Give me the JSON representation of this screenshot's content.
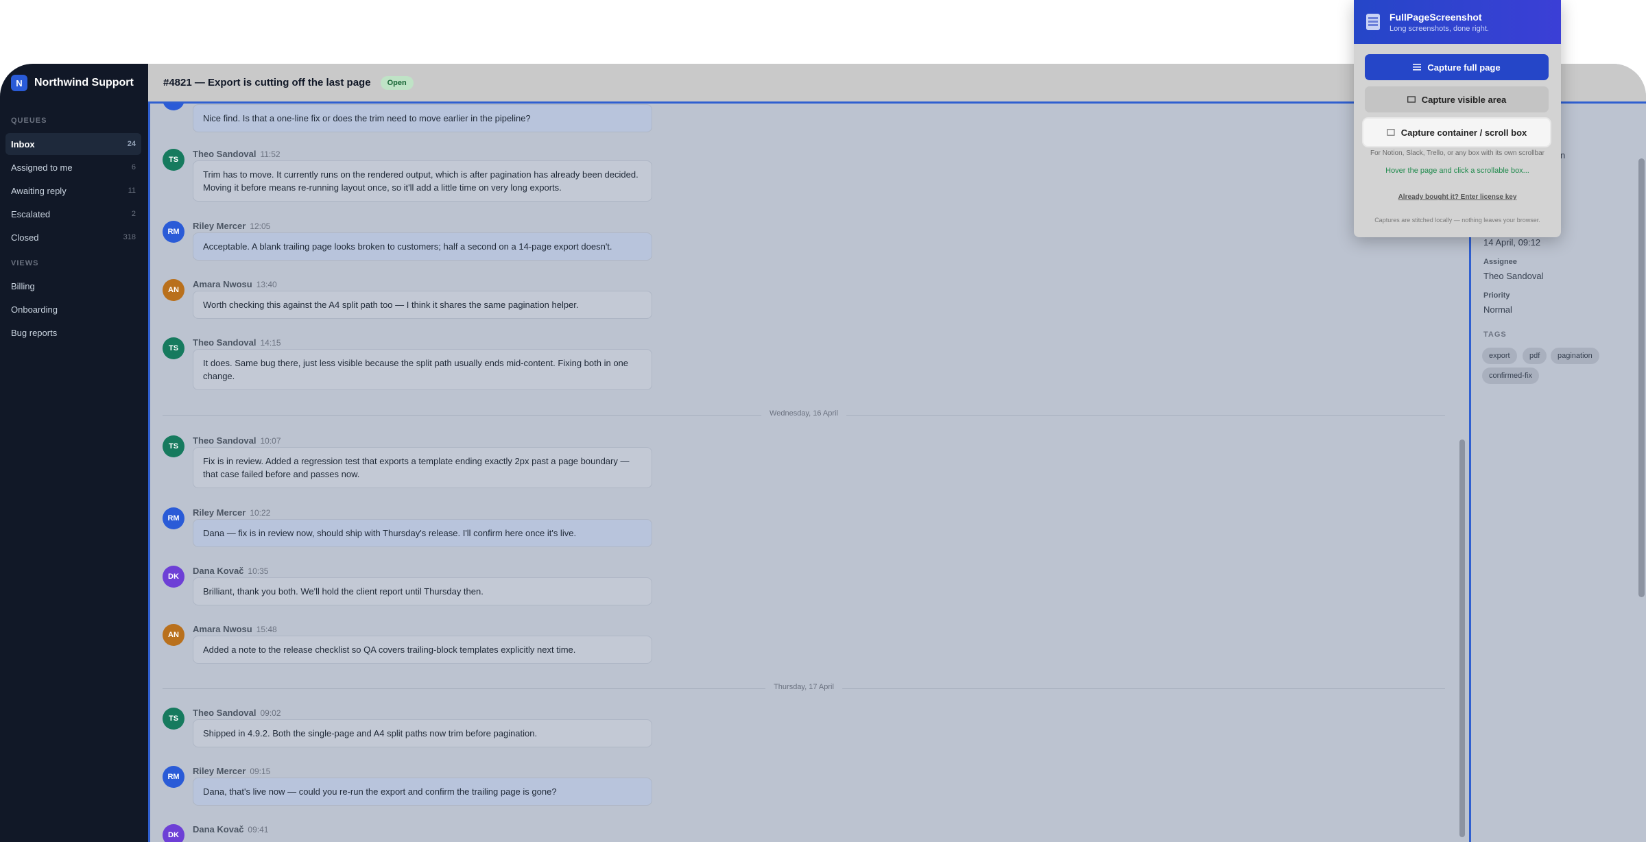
{
  "sidebar": {
    "brand_initial": "N",
    "brand_name": "Northwind Support",
    "queues_label": "QUEUES",
    "queues": [
      {
        "label": "Inbox",
        "count": "24"
      },
      {
        "label": "Assigned to me",
        "count": "6"
      },
      {
        "label": "Awaiting reply",
        "count": "11"
      },
      {
        "label": "Escalated",
        "count": "2"
      },
      {
        "label": "Closed",
        "count": "318"
      }
    ],
    "views_label": "VIEWS",
    "views": [
      {
        "label": "Billing"
      },
      {
        "label": "Onboarding"
      },
      {
        "label": "Bug reports"
      }
    ]
  },
  "header": {
    "title": "#4821 — Export is cutting off the last page",
    "status": "Open"
  },
  "thread": {
    "messages": [
      {
        "initials": "",
        "author": "",
        "time": "",
        "text": "Nice find. Is that a one-line fix or does the trim need to move earlier in the pipeline?"
      },
      {
        "initials": "TS",
        "author": "Theo Sandoval",
        "time": "11:52",
        "text": "Trim has to move. It currently runs on the rendered output, which is after pagination has already been decided. Moving it before means re-running layout once, so it'll add a little time on very long exports."
      },
      {
        "initials": "RM",
        "author": "Riley Mercer",
        "time": "12:05",
        "text": "Acceptable. A blank trailing page looks broken to customers; half a second on a 14-page export doesn't."
      },
      {
        "initials": "AN",
        "author": "Amara Nwosu",
        "time": "13:40",
        "text": "Worth checking this against the A4 split path too — I think it shares the same pagination helper."
      },
      {
        "initials": "TS",
        "author": "Theo Sandoval",
        "time": "14:15",
        "text": "It does. Same bug there, just less visible because the split path usually ends mid-content. Fixing both in one change."
      },
      {
        "initials": "TS",
        "author": "Theo Sandoval",
        "time": "10:07",
        "text": "Fix is in review. Added a regression test that exports a template ending exactly 2px past a page boundary — that case failed before and passes now."
      },
      {
        "initials": "RM",
        "author": "Riley Mercer",
        "time": "10:22",
        "text": "Dana — fix is in review now, should ship with Thursday's release. I'll confirm here once it's live."
      },
      {
        "initials": "DK",
        "author": "Dana Kovač",
        "time": "10:35",
        "text": "Brilliant, thank you both. We'll hold the client report until Thursday then."
      },
      {
        "initials": "AN",
        "author": "Amara Nwosu",
        "time": "15:48",
        "text": "Added a note to the release checklist so QA covers trailing-block templates explicitly next time."
      },
      {
        "initials": "TS",
        "author": "Theo Sandoval",
        "time": "09:02",
        "text": "Shipped in 4.9.2. Both the single-page and A4 split paths now trim before pagination."
      },
      {
        "initials": "RM",
        "author": "Riley Mercer",
        "time": "09:15",
        "text": "Dana, that's live now — could you re-run the export and confirm the trailing page is gone?"
      },
      {
        "initials": "DK",
        "author": "Dana Kovač",
        "time": "09:41",
        "text": ""
      }
    ],
    "dividers": [
      "Wednesday, 16 April",
      "Thursday, 17 April"
    ]
  },
  "details": {
    "created_value": "14 April, 09:12",
    "assignee_label": "Assignee",
    "assignee_value": "Theo Sandoval",
    "priority_label": "Priority",
    "priority_value": "Normal",
    "tags_label": "TAGS",
    "tags": [
      "export",
      "pdf",
      "pagination",
      "confirmed-fix"
    ],
    "partial_text": "n"
  },
  "popup": {
    "title": "FullPageScreenshot",
    "subtitle": "Long screenshots, done right.",
    "btn_full": "Capture full page",
    "btn_visible": "Capture visible area",
    "btn_container": "Capture container / scroll box",
    "help": "For Notion, Slack, Trello, or any box with its own scrollbar",
    "hover_hint": "Hover the page and click a scrollable box...",
    "license": "Already bought it? Enter license key",
    "footer": "Captures are stitched locally — nothing leaves your browser."
  },
  "colors": {
    "accent": "#2546c8",
    "sidebar_bg": "#111827",
    "avatar_ts": "#167a5e",
    "avatar_rm": "#2a5bd7",
    "avatar_an": "#b9701c",
    "avatar_dk": "#6d3fd6"
  },
  "icons": [
    "list-icon",
    "rectangle-icon",
    "box-icon",
    "document-icon"
  ]
}
